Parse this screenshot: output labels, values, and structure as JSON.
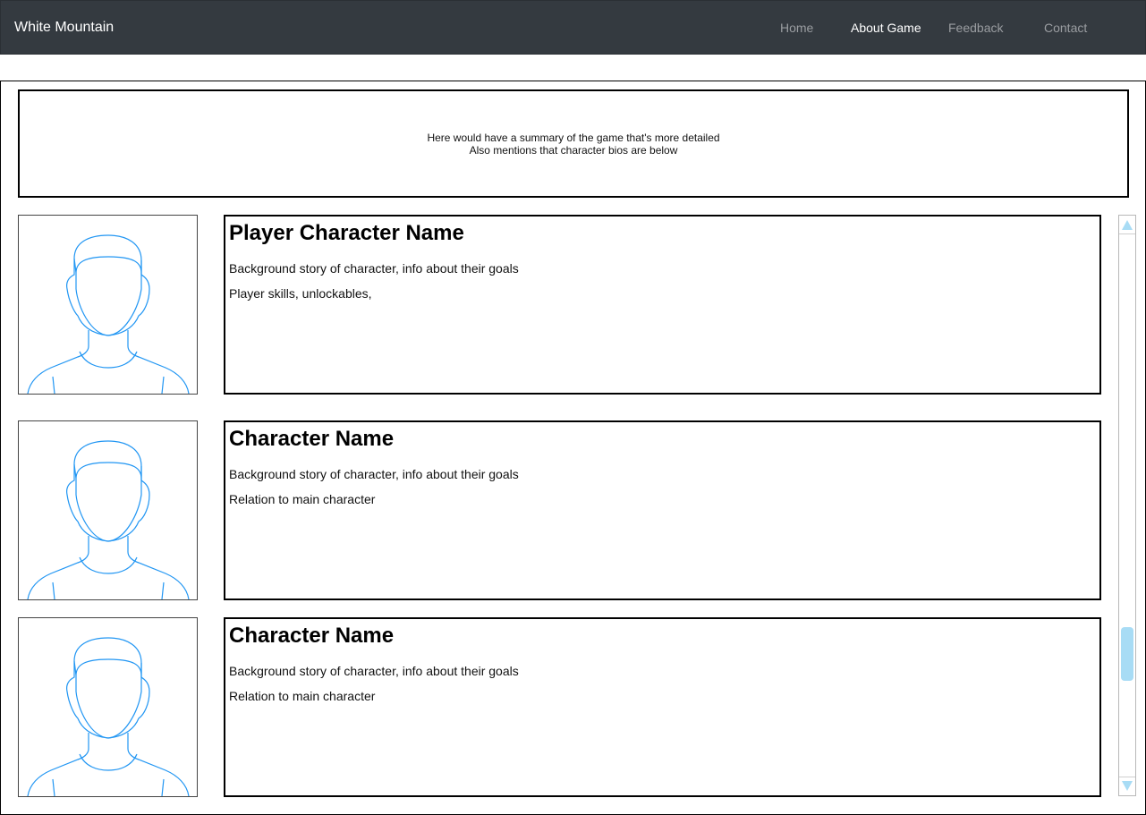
{
  "navbar": {
    "brand": "White Mountain",
    "links": [
      {
        "label": "Home",
        "active": false
      },
      {
        "label": "About Game",
        "active": true
      },
      {
        "label": "Feedback",
        "active": false
      },
      {
        "label": "Contact",
        "active": false
      }
    ]
  },
  "summary": {
    "line1": "Here would have a summary of the game that's more detailed",
    "line2": "Also mentions that character bios are below"
  },
  "characters": [
    {
      "name": "Player Character Name",
      "line1": "Background story of character, info about their goals",
      "line2": "Player skills, unlockables,",
      "avatar_icon": "person-avatar-icon"
    },
    {
      "name": "Character Name",
      "line1": "Background story of character, info about their goals",
      "line2": "Relation to main character",
      "avatar_icon": "person-avatar-icon"
    },
    {
      "name": "Character Name",
      "line1": "Background story of character, info about their goals",
      "line2": "Relation to main character",
      "avatar_icon": "person-avatar-icon"
    }
  ],
  "colors": {
    "navbar_bg": "#343a40",
    "avatar_stroke": "#2196f3",
    "scrollbar_accent": "#a8dcf5"
  }
}
